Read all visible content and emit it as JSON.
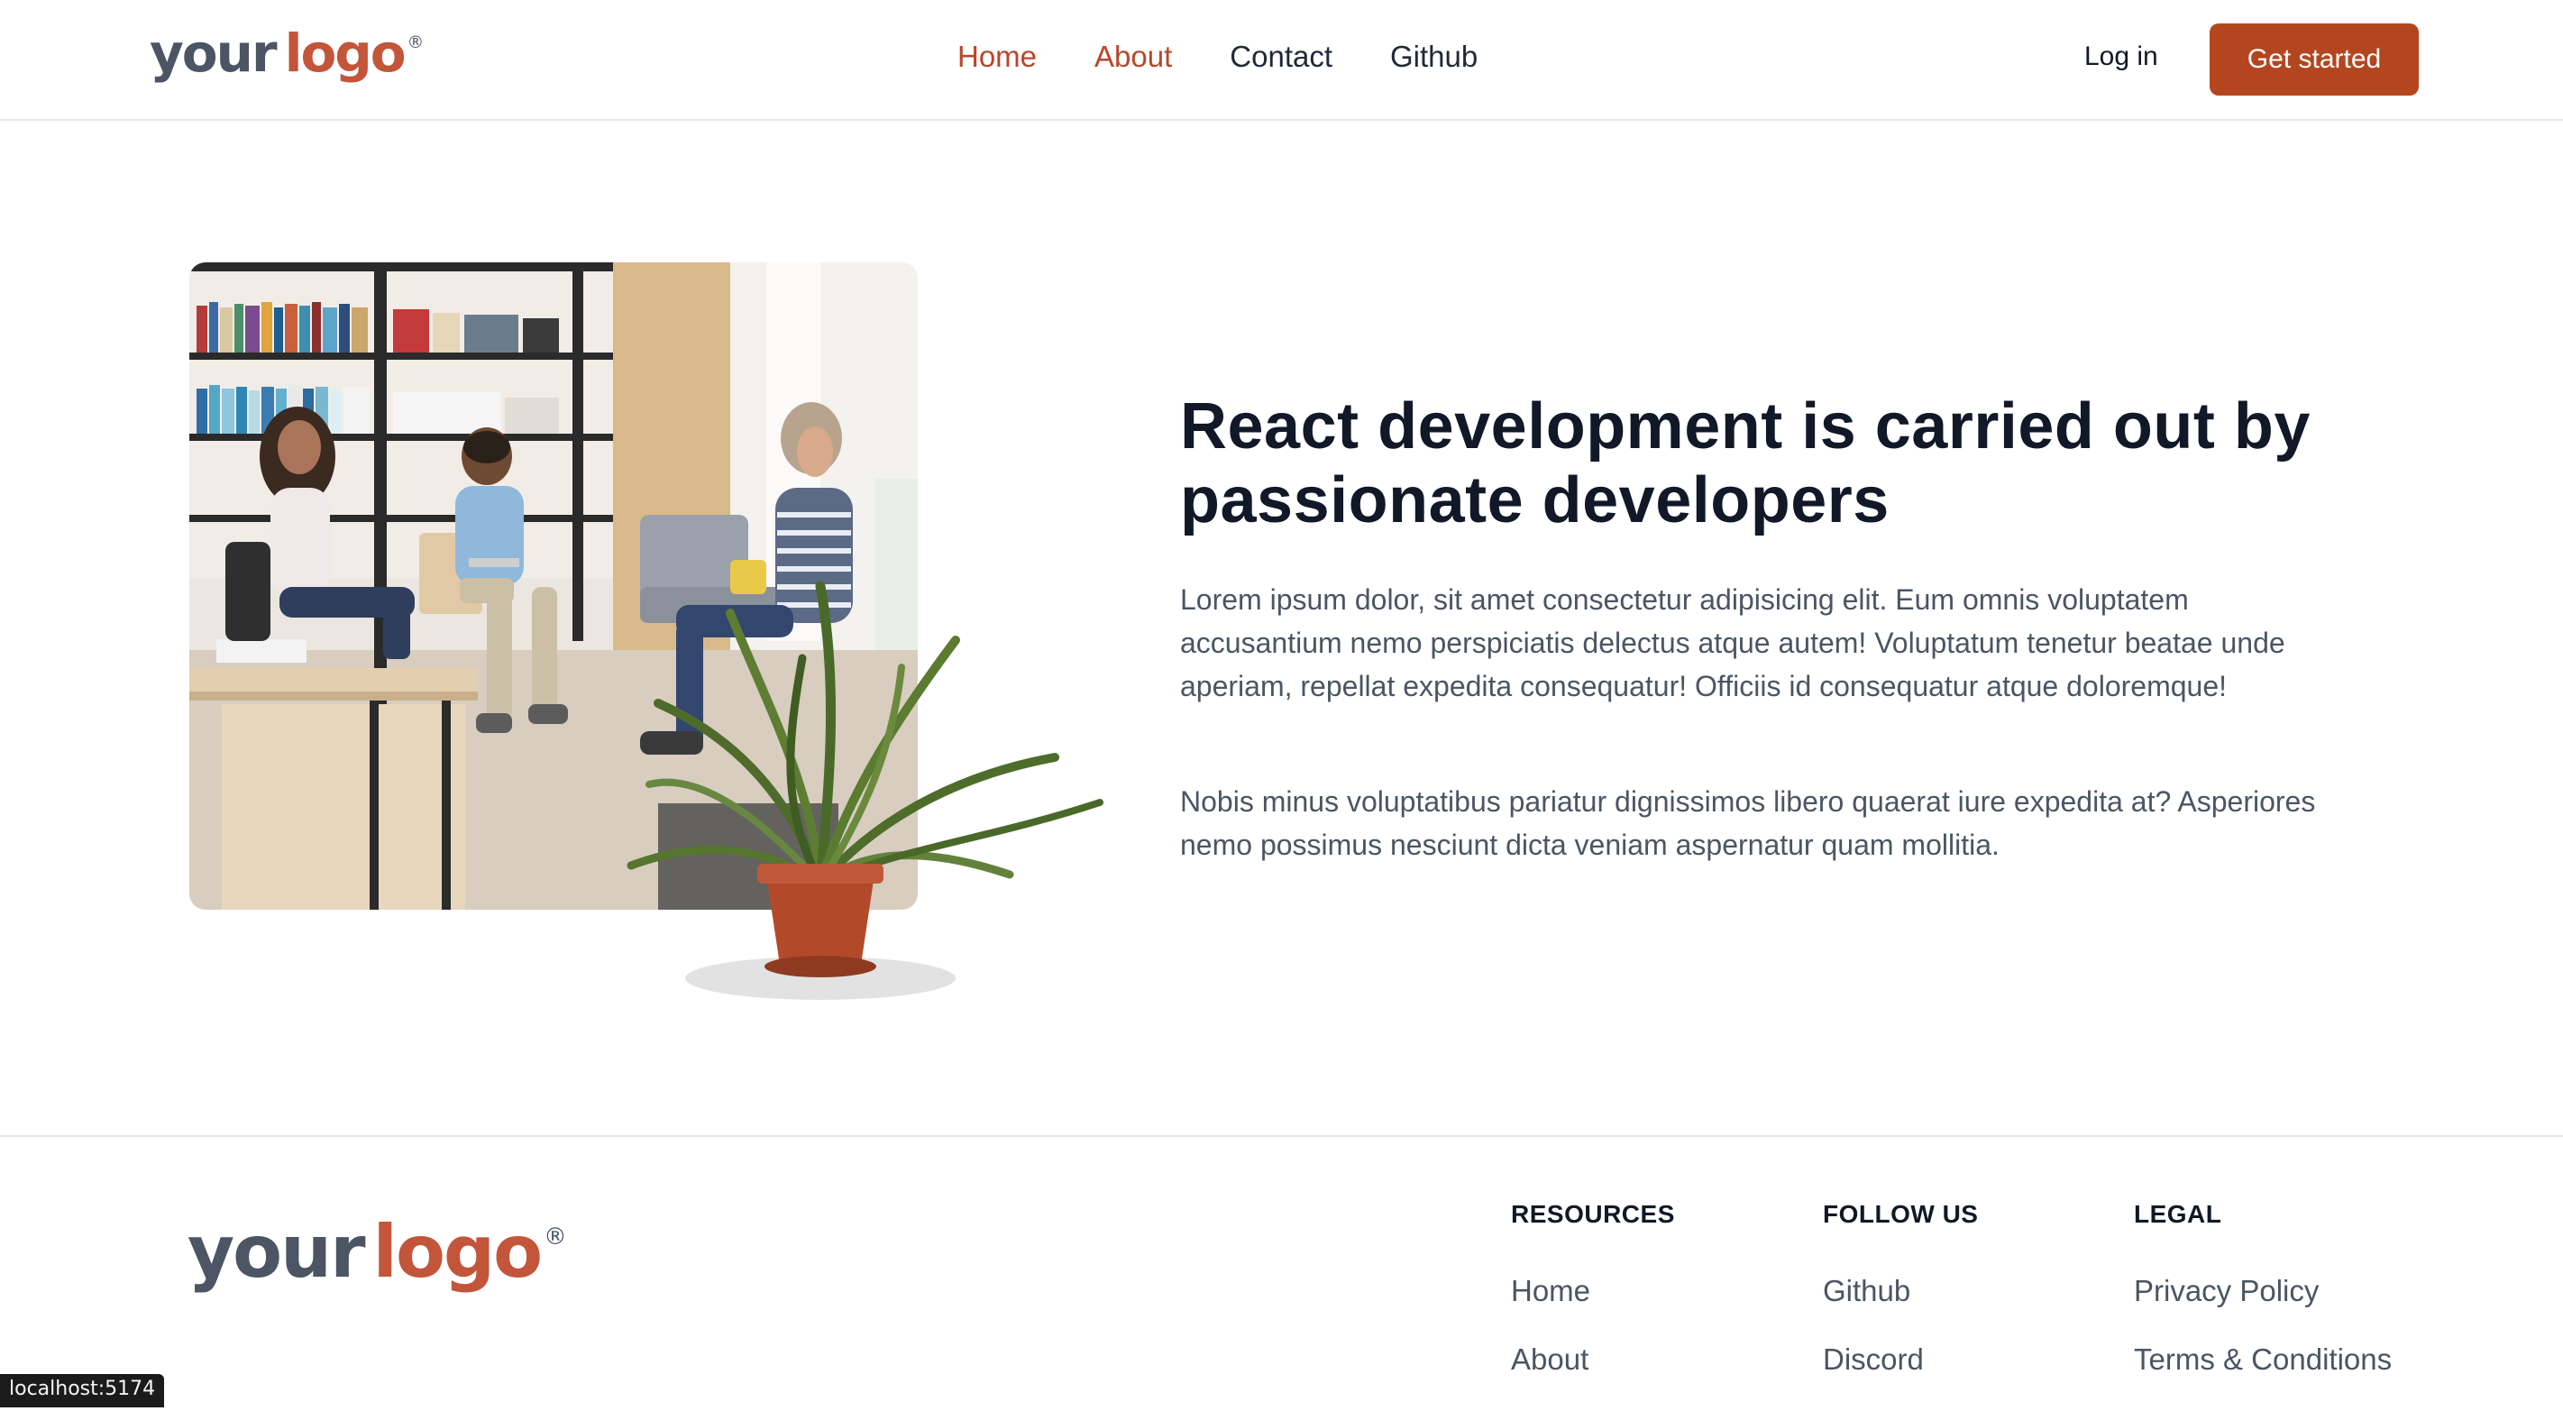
{
  "brand": {
    "word1": "your",
    "word2": "logo",
    "registered": "®",
    "colors": {
      "accent": "#b4461f",
      "logo_orange": "#c2553a",
      "logo_gray": "#4b5563"
    }
  },
  "header": {
    "nav": [
      {
        "label": "Home",
        "active": true
      },
      {
        "label": "About",
        "active": true
      },
      {
        "label": "Contact",
        "active": false
      },
      {
        "label": "Github",
        "active": false
      }
    ],
    "login_label": "Log in",
    "cta_label": "Get started"
  },
  "hero": {
    "title": "React development is carried out by passionate developers",
    "paragraph1": "Lorem ipsum dolor, sit amet consectetur adipisicing elit. Eum omnis voluptatem accusantium nemo perspiciatis delectus atque autem! Voluptatum tenetur beatae unde aperiam, repellat expedita consequatur! Officiis id consequatur atque doloremque!",
    "paragraph2": "Nobis minus voluptatibus pariatur dignissimos libero quaerat iure expedita at? Asperiores nemo possimus nesciunt dicta veniam aspernatur quam mollitia."
  },
  "footer": {
    "columns": [
      {
        "title": "RESOURCES",
        "links": [
          "Home",
          "About"
        ]
      },
      {
        "title": "FOLLOW US",
        "links": [
          "Github",
          "Discord"
        ]
      },
      {
        "title": "LEGAL",
        "links": [
          "Privacy Policy",
          "Terms & Conditions"
        ]
      }
    ]
  },
  "status_bar": {
    "url": "localhost:5174"
  }
}
